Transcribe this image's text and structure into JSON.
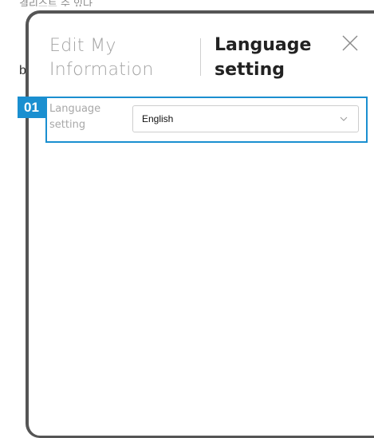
{
  "background": {
    "top_text": "결리스트 수 있다",
    "left_char": "b"
  },
  "modal": {
    "tabs": {
      "edit_info": "Edit My Information",
      "language": "Language setting"
    },
    "close_icon": "close-icon"
  },
  "annotation": {
    "badge": "01",
    "color": "#1a8fd0"
  },
  "language_setting": {
    "label": "Language setting",
    "selected": "English",
    "dropdown_icon": "chevron-down-icon"
  }
}
